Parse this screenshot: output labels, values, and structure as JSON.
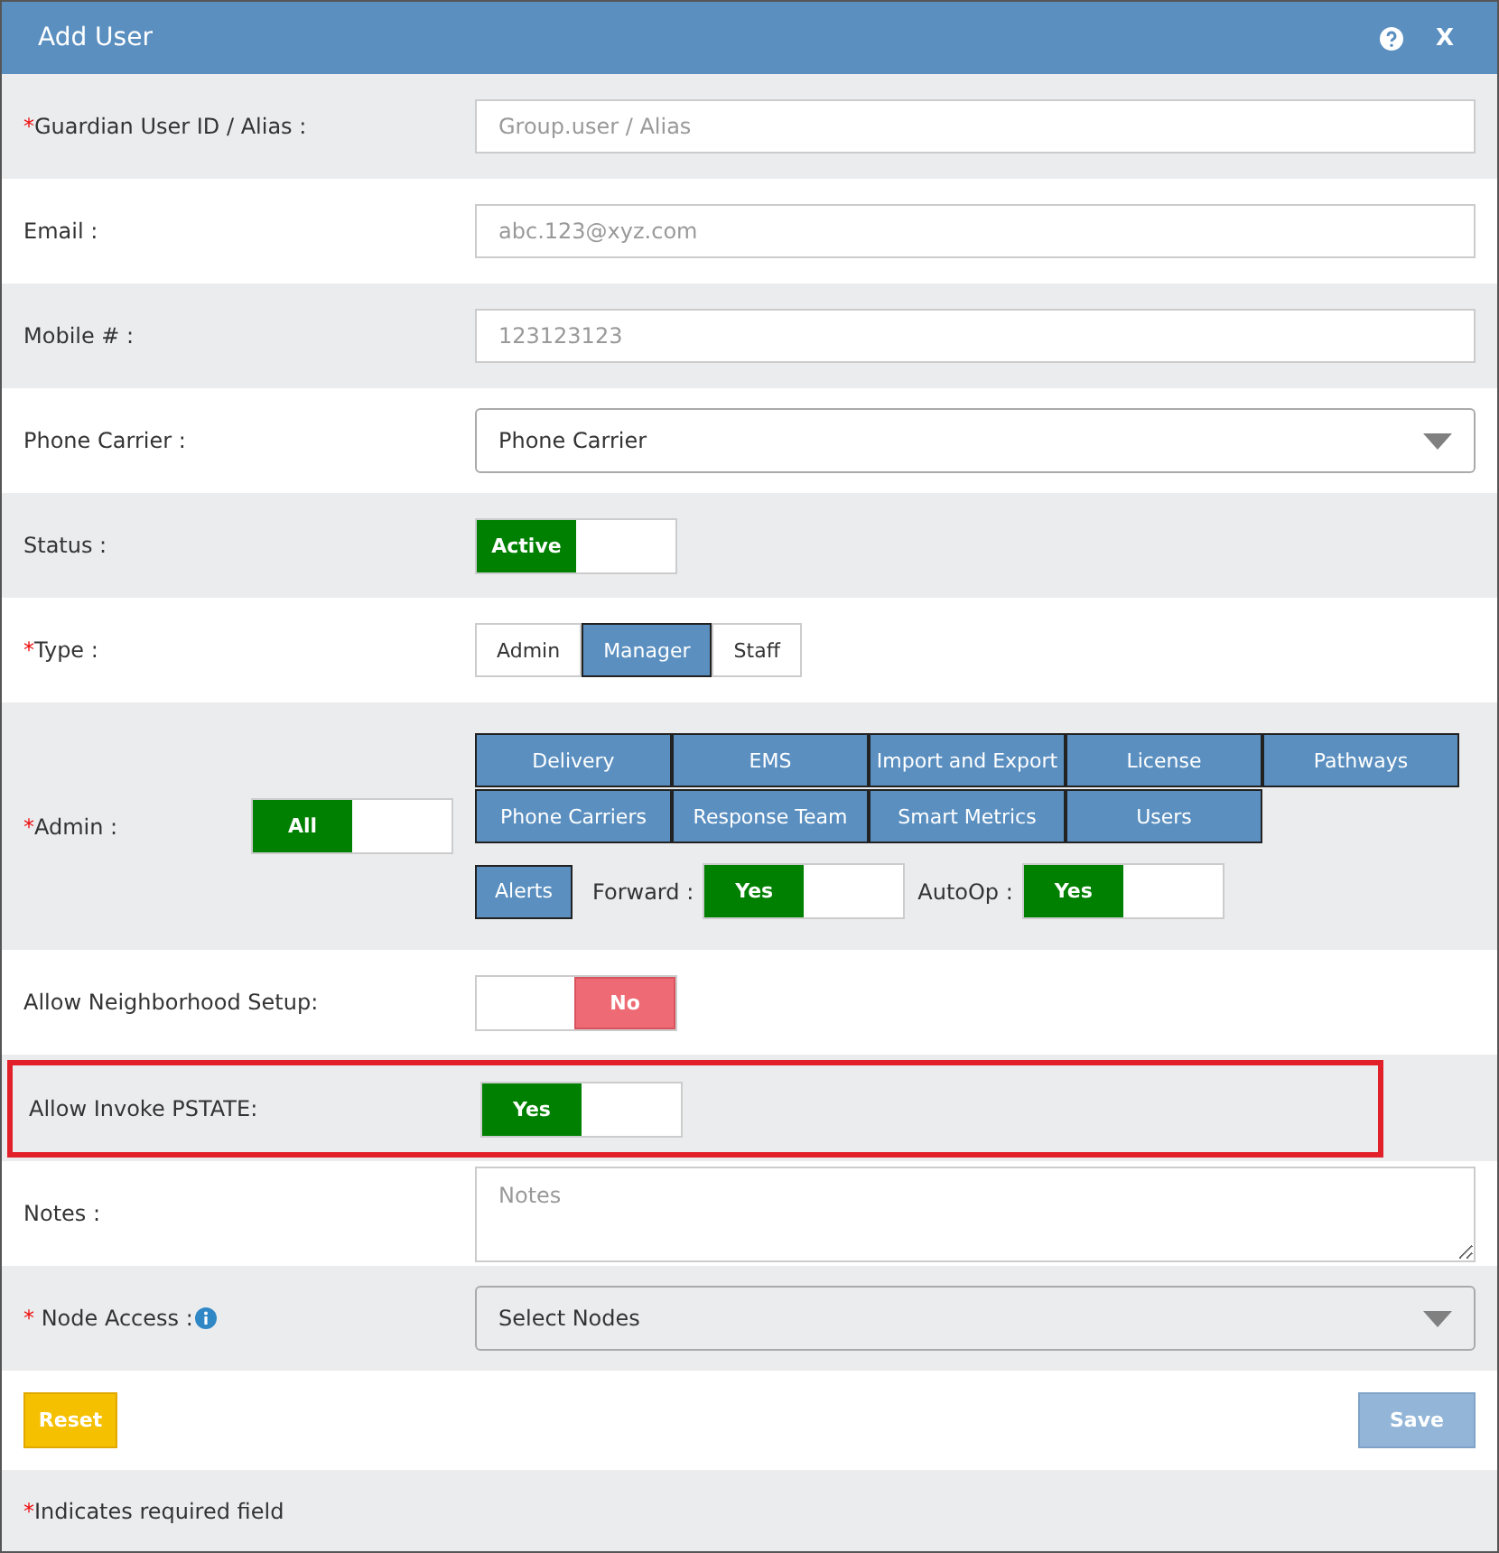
{
  "window": {
    "title": "Add User",
    "help_icon": true,
    "close": "X"
  },
  "rows": [
    {
      "kind": "input",
      "mark": "*",
      "label": "Guardian User ID / Alias :",
      "placeholder": "Group.user / Alias"
    },
    {
      "kind": "input",
      "label": "Email :",
      "placeholder": "abc.123@xyz.com"
    },
    {
      "kind": "input",
      "label": "Mobile # :",
      "placeholder": "123123123"
    },
    {
      "kind": "select",
      "label": "Phone Carrier :",
      "value": "Phone Carrier"
    },
    {
      "kind": "toggle",
      "label": "Status :",
      "toggle": {
        "label": "Active",
        "on": true
      }
    },
    {
      "kind": "segmented",
      "mark": "*",
      "label": "Type :",
      "options": [
        {
          "label": "Admin",
          "selected": false
        },
        {
          "label": "Manager",
          "selected": true
        },
        {
          "label": "Staff",
          "selected": false
        }
      ]
    },
    {
      "kind": "admin",
      "mark": "*",
      "label": "Admin :",
      "all": {
        "label": "All",
        "on": true
      },
      "modules": [
        {
          "label": "Delivery",
          "selected": true
        },
        {
          "label": "EMS",
          "selected": true
        },
        {
          "label": "Import and Export",
          "selected": true
        },
        {
          "label": "License",
          "selected": true
        },
        {
          "label": "Pathways",
          "selected": true
        },
        {
          "label": "Phone Carriers",
          "selected": true
        },
        {
          "label": "Response Team",
          "selected": true
        },
        {
          "label": "Smart Metrics",
          "selected": true
        },
        {
          "label": "Users",
          "selected": true
        }
      ],
      "alerts": {
        "label": "Alerts",
        "selected": true
      },
      "sub_toggles": [
        {
          "label": "Forward :",
          "toggle": {
            "label": "Yes",
            "on": true
          }
        },
        {
          "label": "AutoOp :",
          "toggle": {
            "label": "Yes",
            "on": true
          }
        }
      ]
    },
    {
      "kind": "toggle",
      "label": "Allow Neighborhood Setup:",
      "toggle": {
        "label": "No",
        "on": false
      }
    },
    {
      "kind": "toggle",
      "label": "Allow Invoke PSTATE:",
      "highlighted": true,
      "toggle": {
        "label": "Yes",
        "on": true
      }
    },
    {
      "kind": "textarea",
      "label": "Notes :",
      "placeholder": "Notes"
    },
    {
      "kind": "select",
      "mark": "*",
      "label": " Node Access :",
      "info_icon": true,
      "value": "Select Nodes"
    }
  ],
  "buttons": {
    "reset": "Reset",
    "save": "Save",
    "save_disabled": true
  },
  "footer": {
    "mark": "*",
    "text": "Indicates required field"
  }
}
